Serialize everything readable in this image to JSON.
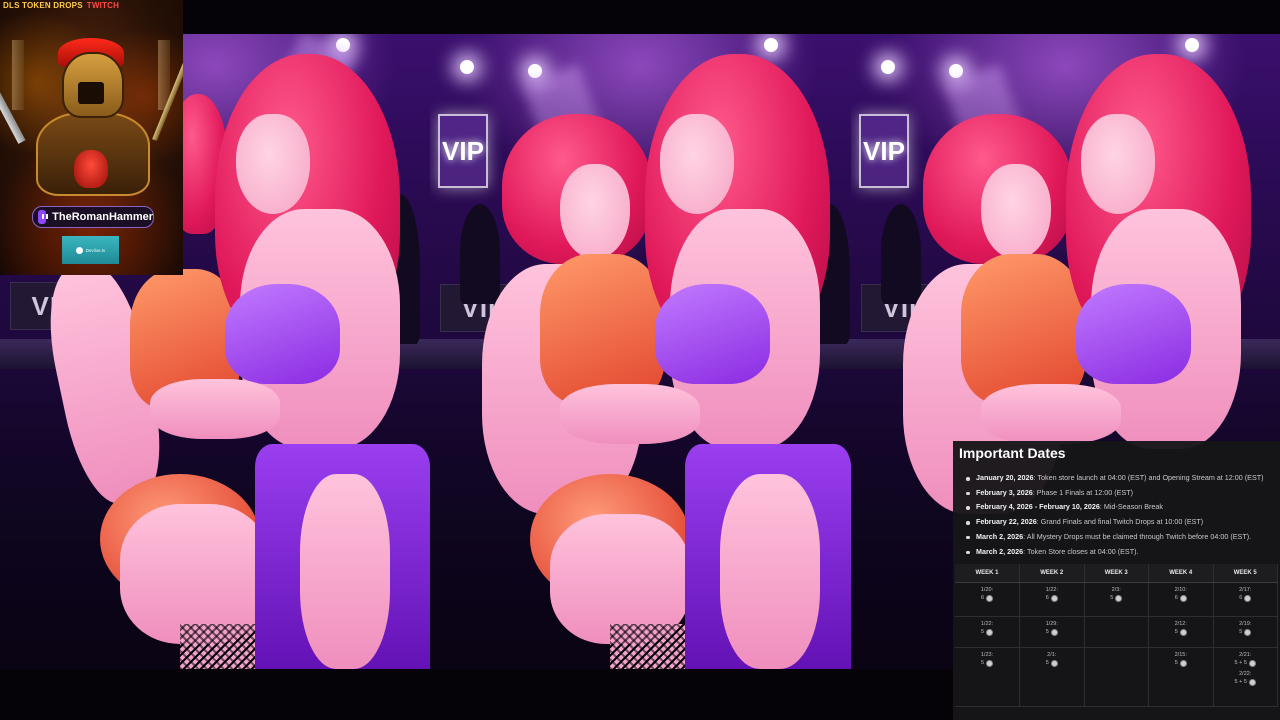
{
  "overlay": {
    "header_left": "DLS TOKEN DROPS",
    "header_right": "TWITCH",
    "icons": [
      "twitch-icon",
      "spartan-helmet-logo",
      "dlv-logo"
    ],
    "channel_handle": "TheRomanHammer",
    "badge_text": "Devlive.tv"
  },
  "scene": {
    "vip_neon": "VIP",
    "vip_sign": "VIP"
  },
  "important_dates": {
    "title": "Important Dates",
    "items": [
      {
        "date": "January 20, 2026",
        "text": ": Token store launch at 04:00 (EST) and Opening Stream at 12:00 (EST)"
      },
      {
        "date": "February 3, 2026",
        "text": ": Phase 1 Finals at 12:00 (EST)"
      },
      {
        "date": "February 4, 2026 - February 10, 2026",
        "text": ": Mid-Season Break"
      },
      {
        "date": "February 22, 2026",
        "text": ": Grand Finals and final Twitch Drops at 10:00 (EST)"
      },
      {
        "date": "March 2, 2026",
        "text": ": All Mystery Drops must be claimed through Twitch before 04:00 (EST)."
      },
      {
        "date": "March 2, 2026",
        "text": ": Token Store closes at 04:00 (EST)."
      }
    ],
    "weeks": [
      "WEEK 1",
      "WEEK 2",
      "WEEK 3",
      "WEEK 4",
      "WEEK 5"
    ],
    "rows": [
      [
        [
          {
            "d": "1/20:",
            "v": "6"
          }
        ],
        [
          {
            "d": "1/22:",
            "v": "6"
          }
        ],
        [
          {
            "d": "2/3:",
            "v": "5"
          }
        ],
        [
          {
            "d": "2/10:",
            "v": "6"
          }
        ],
        [
          {
            "d": "2/17:",
            "v": "6"
          }
        ]
      ],
      [
        [
          {
            "d": "1/22:",
            "v": "5"
          }
        ],
        [
          {
            "d": "1/29:",
            "v": "5"
          }
        ],
        [],
        [
          {
            "d": "2/12:",
            "v": "5"
          }
        ],
        [
          {
            "d": "2/19:",
            "v": "5"
          }
        ]
      ],
      [
        [
          {
            "d": "1/23:",
            "v": "5"
          }
        ],
        [
          {
            "d": "2/1:",
            "v": "5"
          }
        ],
        [],
        [
          {
            "d": "2/15:",
            "v": "5"
          }
        ],
        [
          {
            "d": "2/21:",
            "v": "5 + 5"
          },
          {
            "d": "2/22:",
            "v": "5 + 5"
          }
        ]
      ]
    ],
    "colors": {
      "panel_bg": "#161618",
      "accent": "#9146ff"
    }
  }
}
